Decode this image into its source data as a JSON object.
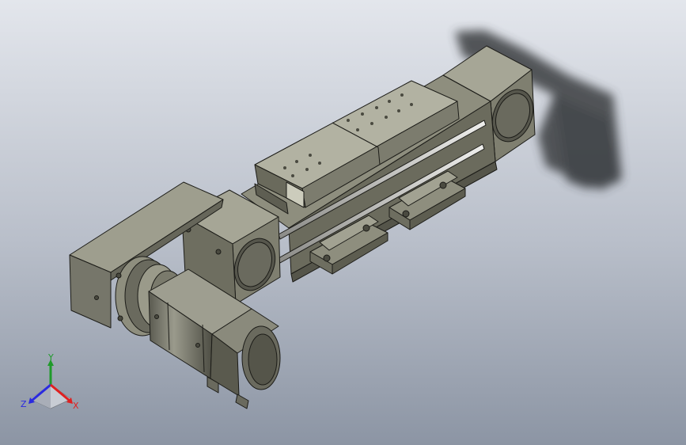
{
  "viewport": {
    "background_top": "#d7dbe3",
    "background_bottom": "#8e97a6"
  },
  "model": {
    "body_color": "#7a7a6a",
    "body_light": "#9a9a8a",
    "body_dark": "#55554a",
    "edge_color": "#1c1c18",
    "rod_color": "#d0d0cc",
    "shadow_color": "#3a3d40"
  },
  "triad": {
    "y_label": "Y",
    "z_label": "Z",
    "x_label": "X",
    "y_color": "#1f9a2a",
    "z_color": "#2a2ae0",
    "x_color": "#e02020"
  }
}
